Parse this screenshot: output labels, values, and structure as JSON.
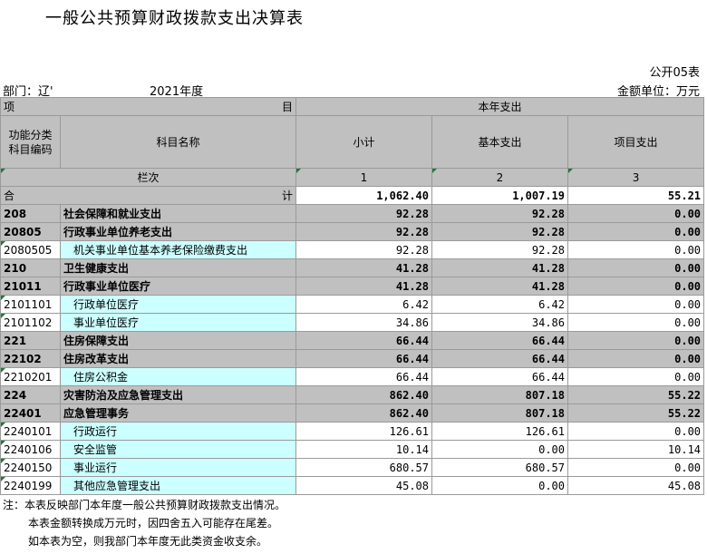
{
  "title": "一般公共预算财政拨款支出决算表",
  "table_code": "公开05表",
  "department_label": "部门：辽'",
  "year": "2021年度",
  "unit": "金额单位：万元",
  "header": {
    "item_left": "项",
    "item_right": "目",
    "this_year": "本年支出",
    "func_code": "功能分类\n科目编码",
    "subject_name": "科目名称",
    "subtotal": "小计",
    "basic": "基本支出",
    "project": "项目支出",
    "row_label": "栏次",
    "col1": "1",
    "col2": "2",
    "col3": "3"
  },
  "total": {
    "left": "合",
    "right": "计",
    "subtotal": "1,062.40",
    "basic": "1,007.19",
    "project": "55.21"
  },
  "rows": [
    {
      "code": "208",
      "name": "社会保障和就业支出",
      "subtotal": "92.28",
      "basic": "92.28",
      "project": "0.00",
      "level": 1
    },
    {
      "code": "20805",
      "name": "行政事业单位养老支出",
      "subtotal": "92.28",
      "basic": "92.28",
      "project": "0.00",
      "level": 1
    },
    {
      "code": "2080505",
      "name": "机关事业单位基本养老保险缴费支出",
      "subtotal": "92.28",
      "basic": "92.28",
      "project": "0.00",
      "level": 3
    },
    {
      "code": "210",
      "name": "卫生健康支出",
      "subtotal": "41.28",
      "basic": "41.28",
      "project": "0.00",
      "level": 1
    },
    {
      "code": "21011",
      "name": "行政事业单位医疗",
      "subtotal": "41.28",
      "basic": "41.28",
      "project": "0.00",
      "level": 1
    },
    {
      "code": "2101101",
      "name": "行政单位医疗",
      "subtotal": "6.42",
      "basic": "6.42",
      "project": "0.00",
      "level": 3
    },
    {
      "code": "2101102",
      "name": "事业单位医疗",
      "subtotal": "34.86",
      "basic": "34.86",
      "project": "0.00",
      "level": 3
    },
    {
      "code": "221",
      "name": "住房保障支出",
      "subtotal": "66.44",
      "basic": "66.44",
      "project": "0.00",
      "level": 1
    },
    {
      "code": "22102",
      "name": "住房改革支出",
      "subtotal": "66.44",
      "basic": "66.44",
      "project": "0.00",
      "level": 1
    },
    {
      "code": "2210201",
      "name": "住房公积金",
      "subtotal": "66.44",
      "basic": "66.44",
      "project": "0.00",
      "level": 3
    },
    {
      "code": "224",
      "name": "灾害防治及应急管理支出",
      "subtotal": "862.40",
      "basic": "807.18",
      "project": "55.22",
      "level": 1
    },
    {
      "code": "22401",
      "name": "应急管理事务",
      "subtotal": "862.40",
      "basic": "807.18",
      "project": "55.22",
      "level": 1
    },
    {
      "code": "2240101",
      "name": "行政运行",
      "subtotal": "126.61",
      "basic": "126.61",
      "project": "0.00",
      "level": 3
    },
    {
      "code": "2240106",
      "name": "安全监管",
      "subtotal": "10.14",
      "basic": "0.00",
      "project": "10.14",
      "level": 3
    },
    {
      "code": "2240150",
      "name": "事业运行",
      "subtotal": "680.57",
      "basic": "680.57",
      "project": "0.00",
      "level": 3
    },
    {
      "code": "2240199",
      "name": "其他应急管理支出",
      "subtotal": "45.08",
      "basic": "0.00",
      "project": "45.08",
      "level": 3
    }
  ],
  "notes": [
    "注：本表反映部门本年度一般公共预算财政拨款支出情况。",
    "本表金额转换成万元时，因四舍五入可能存在尾差。",
    "如本表为空，则我部门本年度无此类资金收支余。"
  ]
}
